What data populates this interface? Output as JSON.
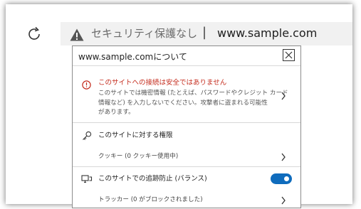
{
  "toolbar": {
    "refresh_icon": "refresh-icon",
    "warning_icon": "warning-triangle-icon",
    "security_status": "セキュリティ保護なし",
    "separator": "|",
    "url": "www.sample.com"
  },
  "popup": {
    "title": "www.sample.comについて",
    "close_icon": "close-icon",
    "connection": {
      "icon": "info-circle-icon",
      "title": "このサイトへの接続は安全ではありません",
      "description_lines": [
        "このサイトでは機密情報 (たとえば、パスワードやクレジット カード",
        "情報など) を入力しないでください。攻撃者に盗まれる可能性",
        "があります。"
      ]
    },
    "permissions": {
      "icon": "key-icon",
      "title": "このサイトに対する権限",
      "cookies": "クッキー (0 クッキー使用中)"
    },
    "tracking": {
      "icon": "tracking-prevention-icon",
      "title": "このサイトでの追跡防止 (バランス)",
      "toggle_on": true,
      "trackers": "トラッカー (0 がブロックされました)"
    }
  },
  "colors": {
    "warning_red": "#c42b1c",
    "toggle_blue": "#0f6cbd"
  }
}
